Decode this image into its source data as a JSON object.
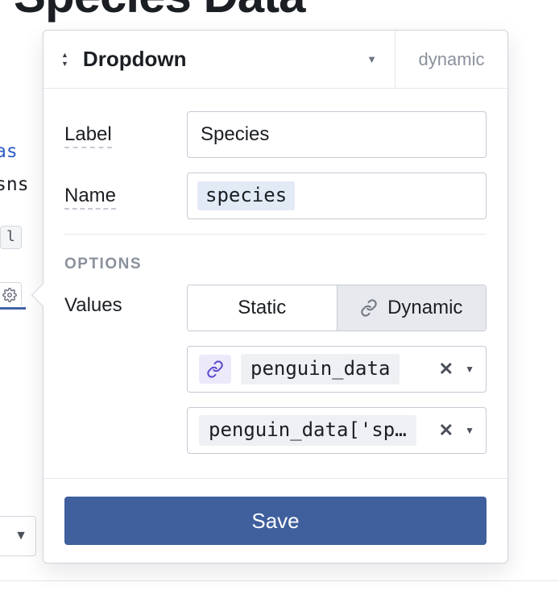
{
  "background": {
    "title_fragment": "in Species Data",
    "code_line1_kw": "as",
    "code_line2": "sns",
    "chip": "l",
    "gear_icon": "gear"
  },
  "panel": {
    "type": "Dropdown",
    "mode_label": "dynamic",
    "label_field": {
      "label": "Label",
      "value": "Species"
    },
    "name_field": {
      "label": "Name",
      "value": "species"
    },
    "options_section_title": "OPTIONS",
    "values_label": "Values",
    "toggle": {
      "static": "Static",
      "dynamic": "Dynamic",
      "active": "dynamic"
    },
    "bindings": [
      {
        "has_link_badge": true,
        "text": "penguin_data"
      },
      {
        "has_link_badge": false,
        "text": "penguin_data['sp…"
      }
    ],
    "save_label": "Save"
  }
}
